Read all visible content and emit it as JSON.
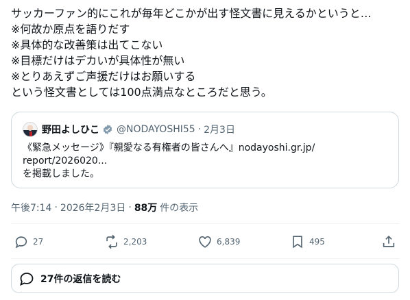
{
  "tweet": {
    "lines": [
      "サッカーファン的にこれが毎年どこかが出す怪文書に見えるかというと…",
      "※何故か原点を語りだす",
      "※具体的な改善策は出てこない",
      "※目標だけはデカいが具体性が無い",
      "※とりあえずご声援だけはお願いする",
      "という怪文書としては100点満点なところだと思う。"
    ]
  },
  "quote": {
    "name": "野田よしひこ",
    "handle": "@NODAYOSHI55",
    "separator": "·",
    "date": "2月3日",
    "body_lines": [
      "《緊急メッセージ》『親愛なる有権者の皆さんへ』nodayoshi.gr.jp/",
      "report/2026020...",
      "を掲載しました。"
    ]
  },
  "meta": {
    "time": "午後7:14",
    "separator": "·",
    "date": "2026年2月3日",
    "views_count": "88万",
    "views_label": "件の表示"
  },
  "actions": {
    "replies": "27",
    "reposts": "2,203",
    "likes": "6,839",
    "bookmarks": "495"
  },
  "replies_button": {
    "label": "27件の返信を読む"
  },
  "colors": {
    "text": "#0f1419",
    "secondary": "#536471",
    "border": "#cfd9de",
    "verified": "#829aab"
  },
  "icons": [
    "reply-icon",
    "repost-icon",
    "like-icon",
    "bookmark-icon",
    "share-icon",
    "verified-icon",
    "speech-bubble-icon"
  ]
}
